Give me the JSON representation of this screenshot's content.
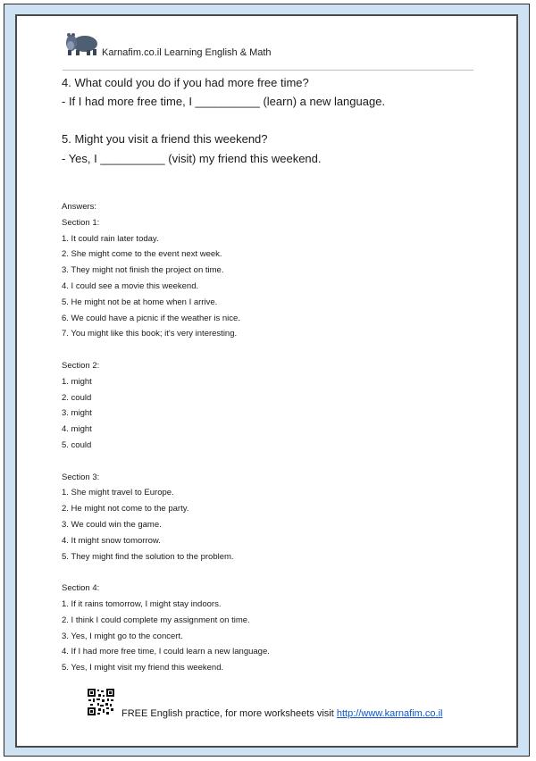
{
  "header": {
    "brand": "Karnafim.co.il Learning English & Math",
    "logo_icon": "hippo-icon"
  },
  "questions": [
    {
      "prompt": "4. What could you do if you had more free time?",
      "answer_line": "- If I had more free time, I __________ (learn) a new language."
    },
    {
      "prompt": "5. Might you visit a friend this weekend?",
      "answer_line": "- Yes, I __________ (visit) my friend this weekend."
    }
  ],
  "answers": {
    "title": "Answers:",
    "sections": [
      {
        "title": "Section 1:",
        "items": [
          "1. It could rain later today.",
          "2. She might come to the event next week.",
          "3. They might not finish the project on time.",
          "4. I could see a movie this weekend.",
          "5. He might not be at home when I arrive.",
          "6. We could have a picnic if the weather is nice.",
          "7. You might like this book; it's very interesting."
        ]
      },
      {
        "title": "Section 2:",
        "items": [
          "1. might",
          "2. could",
          "3. might",
          "4. might",
          "5. could"
        ]
      },
      {
        "title": "Section 3:",
        "items": [
          "1. She might travel to Europe.",
          "2. He might not come to the party.",
          "3. We could win the game.",
          "4. It might snow tomorrow.",
          "5. They might find the solution to the problem."
        ]
      },
      {
        "title": "Section 4:",
        "items": [
          "1. If it rains tomorrow, I might stay indoors.",
          "2. I think I could complete my assignment on time.",
          "3. Yes, I might go to the concert.",
          "4. If I had more free time, I could learn a new language.",
          "5. Yes, I might visit my friend this weekend."
        ]
      }
    ]
  },
  "footer": {
    "text": "FREE English practice, for more worksheets visit ",
    "link_text": "http://www.karnafim.co.il",
    "qr_icon": "qr-code-icon"
  },
  "colors": {
    "frame_fill": "#cfe2f3",
    "page_border": "#4a4a4a",
    "link": "#1155cc"
  }
}
